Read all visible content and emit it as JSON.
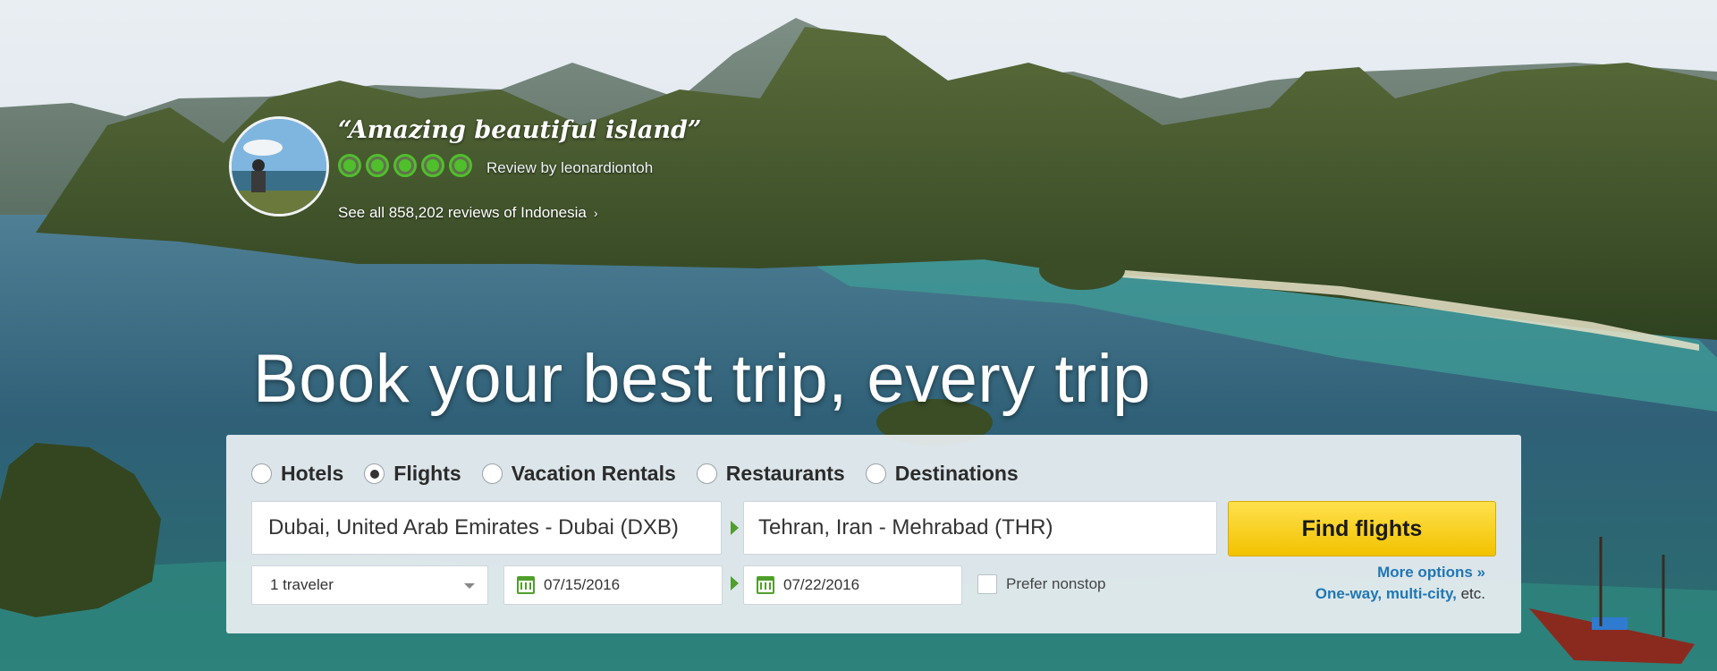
{
  "review": {
    "quote": "“Amazing beautiful island”",
    "bubble_rating": 5,
    "review_by": "Review by leonardiontoh",
    "see_all": "See all 858,202 reviews of Indonesia",
    "see_all_chevron": "›"
  },
  "headline": "Book your best trip, every trip",
  "search": {
    "tabs": [
      {
        "label": "Hotels",
        "selected": false
      },
      {
        "label": "Flights",
        "selected": true
      },
      {
        "label": "Vacation Rentals",
        "selected": false
      },
      {
        "label": "Restaurants",
        "selected": false
      },
      {
        "label": "Destinations",
        "selected": false
      }
    ],
    "origin": "Dubai, United Arab Emirates - Dubai (DXB)",
    "destination": "Tehran, Iran - Mehrabad (THR)",
    "find_button": "Find flights",
    "travelers": "1 traveler",
    "depart_date": "07/15/2016",
    "return_date": "07/22/2016",
    "prefer_nonstop": "Prefer nonstop",
    "more_options": "More options »",
    "one_way": "One-way, multi-city,",
    "etc": " etc."
  },
  "colors": {
    "accent_green": "#4fa02b",
    "bubble_green": "#4fbf2c",
    "button_yellow": "#f2c200",
    "link_blue": "#1f77b4"
  }
}
